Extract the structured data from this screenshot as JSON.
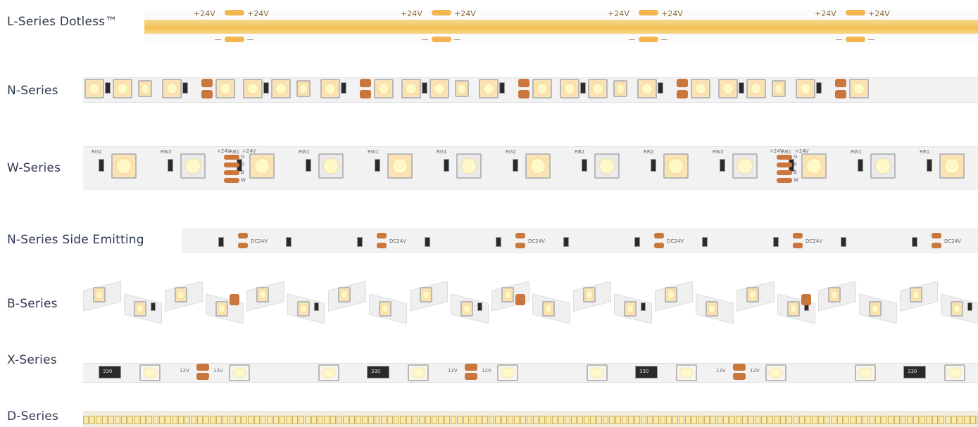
{
  "series": [
    {
      "id": "l",
      "label": "L-Series Dotless™"
    },
    {
      "id": "n",
      "label": "N-Series"
    },
    {
      "id": "w",
      "label": "W-Series"
    },
    {
      "id": "ns",
      "label": "N-Series Side Emitting"
    },
    {
      "id": "b",
      "label": "B-Series"
    },
    {
      "id": "x",
      "label": "X-Series"
    },
    {
      "id": "d",
      "label": "D-Series"
    }
  ],
  "marks": {
    "voltage_24": "+24V",
    "minus": "–",
    "dc24v": "DC24V",
    "v12": "12V",
    "resistor_330": "330",
    "w_codes": [
      "RG2",
      "RW2",
      "RB1",
      "RW1",
      "RW1",
      "RG1",
      "RG2",
      "RB2",
      "RR2",
      "RW2",
      "RB1",
      "RW1",
      "RR1"
    ],
    "rgbw_pins": [
      "G",
      "R",
      "B",
      "W"
    ]
  },
  "colors": {
    "label_text": "#2f3a4f",
    "cob_warm": "#f5c662",
    "copper_pad": "#c9773d",
    "strip_base": "#f2f2f2"
  }
}
